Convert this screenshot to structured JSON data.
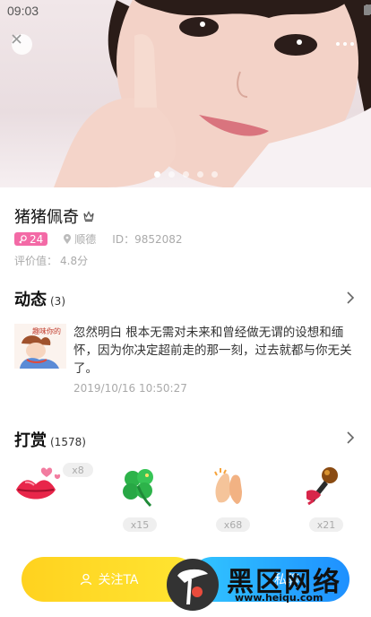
{
  "status_bar": {
    "time": "09:03"
  },
  "hero": {
    "photo_count": 5,
    "active_index": 0
  },
  "profile": {
    "name": "猪猪佩奇",
    "age": "24",
    "location": "顺德",
    "id_label": "ID：",
    "id_value": "9852082",
    "score_label": "评价值：",
    "score_value": "4.8分"
  },
  "moments": {
    "title": "动态",
    "count": "(3)",
    "thumb_caption": "趣味你的",
    "text": "忽然明白 根本无需对未来和曾经做无谓的设想和缅怀，因为你决定超前走的那一刻，过去就都与你无关了。",
    "time": "2019/10/16 10:50:27"
  },
  "gifts": {
    "title": "打赏",
    "count": "(1578)",
    "items": [
      {
        "icon": "lips-icon",
        "count": "x8"
      },
      {
        "icon": "clover-icon",
        "count": "x15"
      },
      {
        "icon": "clapping-hands-icon",
        "count": "x68"
      },
      {
        "icon": "microphone-icon",
        "count": "x21"
      }
    ]
  },
  "actions": {
    "follow_label": "关注TA",
    "chat_label": "私聊"
  },
  "watermark": {
    "text": "黑区网络",
    "url": "www.heiqu.com"
  },
  "colors": {
    "age_badge": "#f36aa6",
    "follow": "#ffd21f",
    "chat": "#1e90ff"
  }
}
